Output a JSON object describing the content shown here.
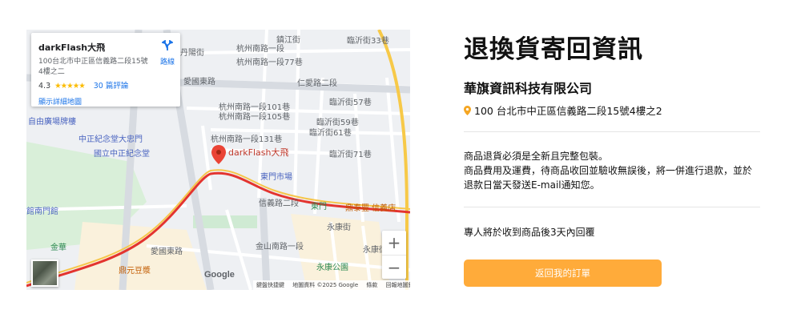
{
  "map": {
    "place_card": {
      "name": "darkFlash大飛",
      "address": "100台北市中正區信義路二段15號4樓之二",
      "rating": "4.3",
      "stars": "★★★★★",
      "reviews": "30 篇評論",
      "route_label": "路線",
      "larger_map": "顯示詳細地圖"
    },
    "marker_label": "darkFlash大飛",
    "street_labels": {
      "s1": "杭州南路一段",
      "s2": "鎮江街",
      "s3": "臨沂街33巷",
      "s4": "杭州南路一段77巷",
      "s5": "丹陽街",
      "s6": "愛國東路",
      "s7": "仁愛路二段",
      "s8": "杭州南路一段101巷",
      "s9": "杭州南路一段105巷",
      "s10": "臨沂街57巷",
      "s11": "臨沂街59巷",
      "s12": "臨沂街61巷",
      "s13": "杭州南路一段131巷",
      "s14": "臨沂街71巷",
      "s15": "信義路二段",
      "s16": "金山南路一段",
      "s17": "愛國東路",
      "s18": "永康街",
      "s19": "永康街"
    },
    "poi": {
      "liberty_square": "自由廣場牌樓",
      "cks_gate": "中正紀念堂大忠門",
      "cks_hall": "國立中正紀念堂",
      "dongmen_market": "東門市場",
      "dongmen_station": "東門",
      "dintaifung": "鼎泰豐 信義店",
      "kouyuan": "鼎元豆漿",
      "yongkang_park": "永康公園",
      "nanmen": "館南門館",
      "jinhua": "金華"
    },
    "zoom_in": "+",
    "zoom_out": "−",
    "google_logo": "Google",
    "attribution": {
      "shortcuts": "鍵盤快捷鍵",
      "data": "地圖資料 ©2025 Google",
      "terms": "條款",
      "report": "回報地圖錯誤"
    }
  },
  "info": {
    "title": "退換貨寄回資訊",
    "company": "華旗資訊科技有限公司",
    "address": "100 台北市中正區信義路二段15號4樓之2",
    "notes": [
      "商品退貨必須是全新且完整包裝。",
      "商品費用及運費，待商品收回並驗收無誤後，將一併進行退款，並於",
      "退款日當天發送E-mail通知您。"
    ],
    "reply": "專人將於收到商品後3天內回覆",
    "button_label": "返回我的訂單"
  },
  "colors": {
    "accent": "#ffab3a",
    "pin": "#f5a623",
    "metro_red": "#e3342f",
    "road_yellow": "#f7c948"
  }
}
